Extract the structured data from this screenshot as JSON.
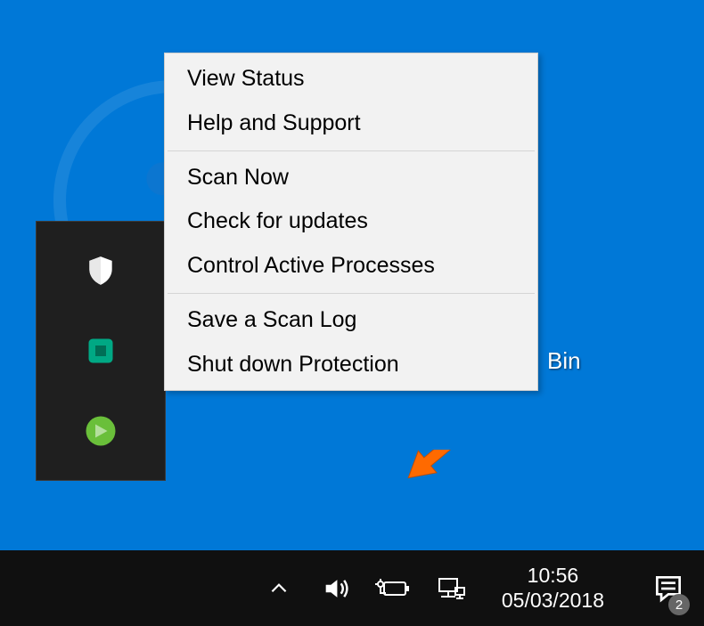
{
  "desktop": {
    "icon_label": "Bin"
  },
  "menu": {
    "groups": [
      [
        "View Status",
        "Help and Support"
      ],
      [
        "Scan Now",
        "Check for updates",
        "Control Active Processes"
      ],
      [
        "Save a Scan Log",
        "Shut down Protection"
      ]
    ]
  },
  "taskbar": {
    "time": "10:56",
    "date": "05/03/2018",
    "notifications": "2"
  },
  "tray_icons": [
    "shield-icon",
    "square-icon",
    "green-dot-icon"
  ],
  "colors": {
    "desktop": "#0078d7",
    "menu_bg": "#f2f2f2",
    "taskbar_bg": "#101010",
    "pointer": "#ff6a00"
  }
}
